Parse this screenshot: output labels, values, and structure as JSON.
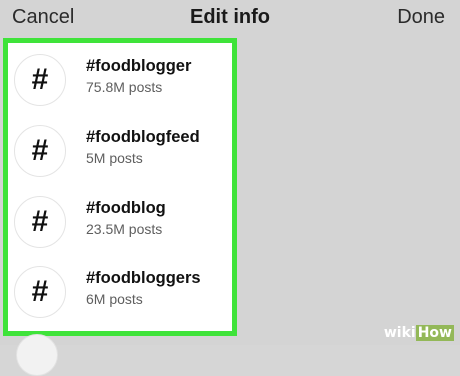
{
  "nav": {
    "cancel_label": "Cancel",
    "title": "Edit info",
    "done_label": "Done"
  },
  "hashtags": [
    {
      "icon": "#",
      "name": "#foodblogger",
      "posts": "75.8M posts"
    },
    {
      "icon": "#",
      "name": "#foodblogfeed",
      "posts": "5M posts"
    },
    {
      "icon": "#",
      "name": "#foodblog",
      "posts": "23.5M posts"
    },
    {
      "icon": "#",
      "name": "#foodbloggers",
      "posts": "6M posts"
    }
  ],
  "watermark": {
    "wiki": "wiki",
    "how": "How"
  },
  "colors": {
    "highlight_border": "#3fe33a",
    "screen_background": "#d4d4d4"
  }
}
